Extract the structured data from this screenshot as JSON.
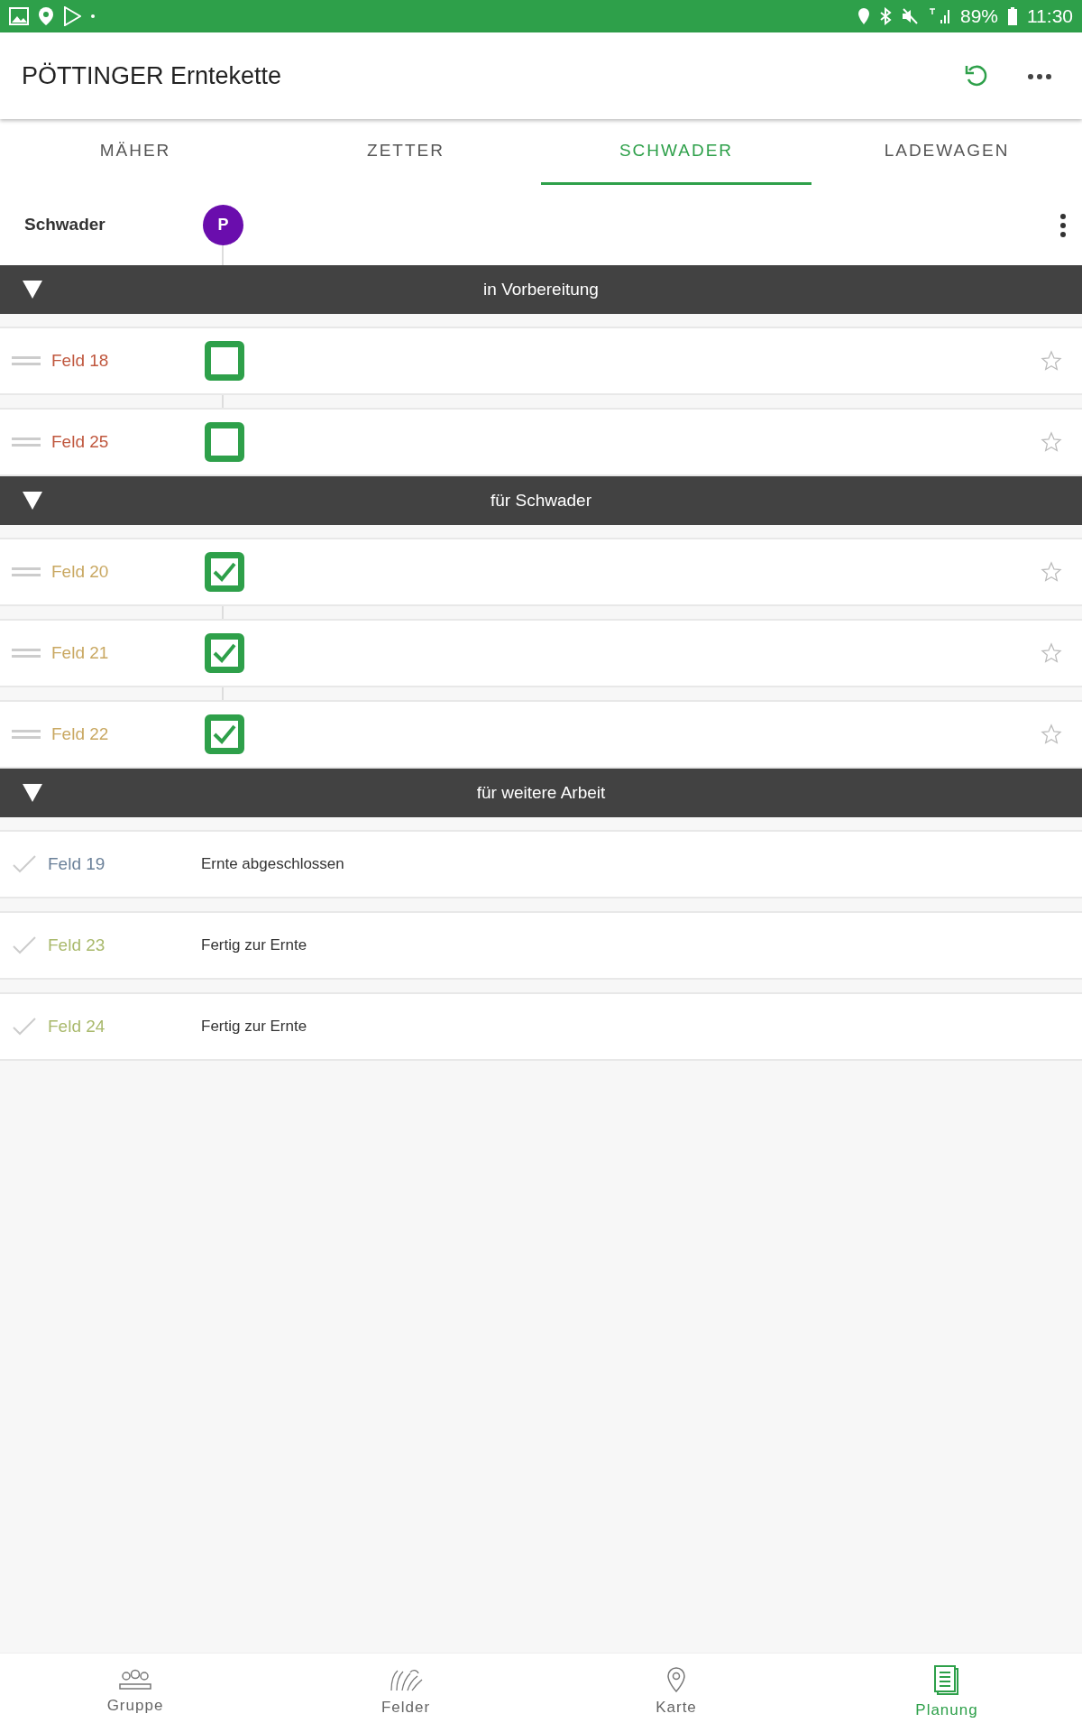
{
  "status_bar": {
    "battery": "89%",
    "time": "11:30"
  },
  "app_bar": {
    "title": "PÖTTINGER Erntekette"
  },
  "tabs": [
    {
      "label": "MÄHER",
      "selected": false
    },
    {
      "label": "ZETTER",
      "selected": false
    },
    {
      "label": "SCHWADER",
      "selected": true
    },
    {
      "label": "LADEWAGEN",
      "selected": false
    }
  ],
  "machine": {
    "label": "Schwader",
    "avatar": "P"
  },
  "sections": [
    {
      "title": "in Vorbereitung",
      "expanded": true,
      "items": [
        {
          "kind": "drag",
          "name": "Feld 18",
          "color": "#c0583f",
          "checked": false
        },
        {
          "kind": "drag",
          "name": "Feld 25",
          "color": "#c0583f",
          "checked": false
        }
      ]
    },
    {
      "title": "für Schwader",
      "expanded": true,
      "items": [
        {
          "kind": "drag",
          "name": "Feld 20",
          "color": "#c9a862",
          "checked": true
        },
        {
          "kind": "drag",
          "name": "Feld 21",
          "color": "#c9a862",
          "checked": true
        },
        {
          "kind": "drag",
          "name": "Feld 22",
          "color": "#c9a862",
          "checked": true
        }
      ]
    },
    {
      "title": "für weitere Arbeit",
      "expanded": true,
      "items": [
        {
          "kind": "done",
          "name": "Feld 19",
          "color": "#6b8199",
          "status": "Ernte abgeschlossen"
        },
        {
          "kind": "done",
          "name": "Feld 23",
          "color": "#a9b96c",
          "status": "Fertig zur Ernte"
        },
        {
          "kind": "done",
          "name": "Feld 24",
          "color": "#a9b96c",
          "status": "Fertig zur Ernte"
        }
      ]
    }
  ],
  "bottom_nav": [
    {
      "label": "Gruppe",
      "selected": false
    },
    {
      "label": "Felder",
      "selected": false
    },
    {
      "label": "Karte",
      "selected": false
    },
    {
      "label": "Planung",
      "selected": true
    }
  ]
}
